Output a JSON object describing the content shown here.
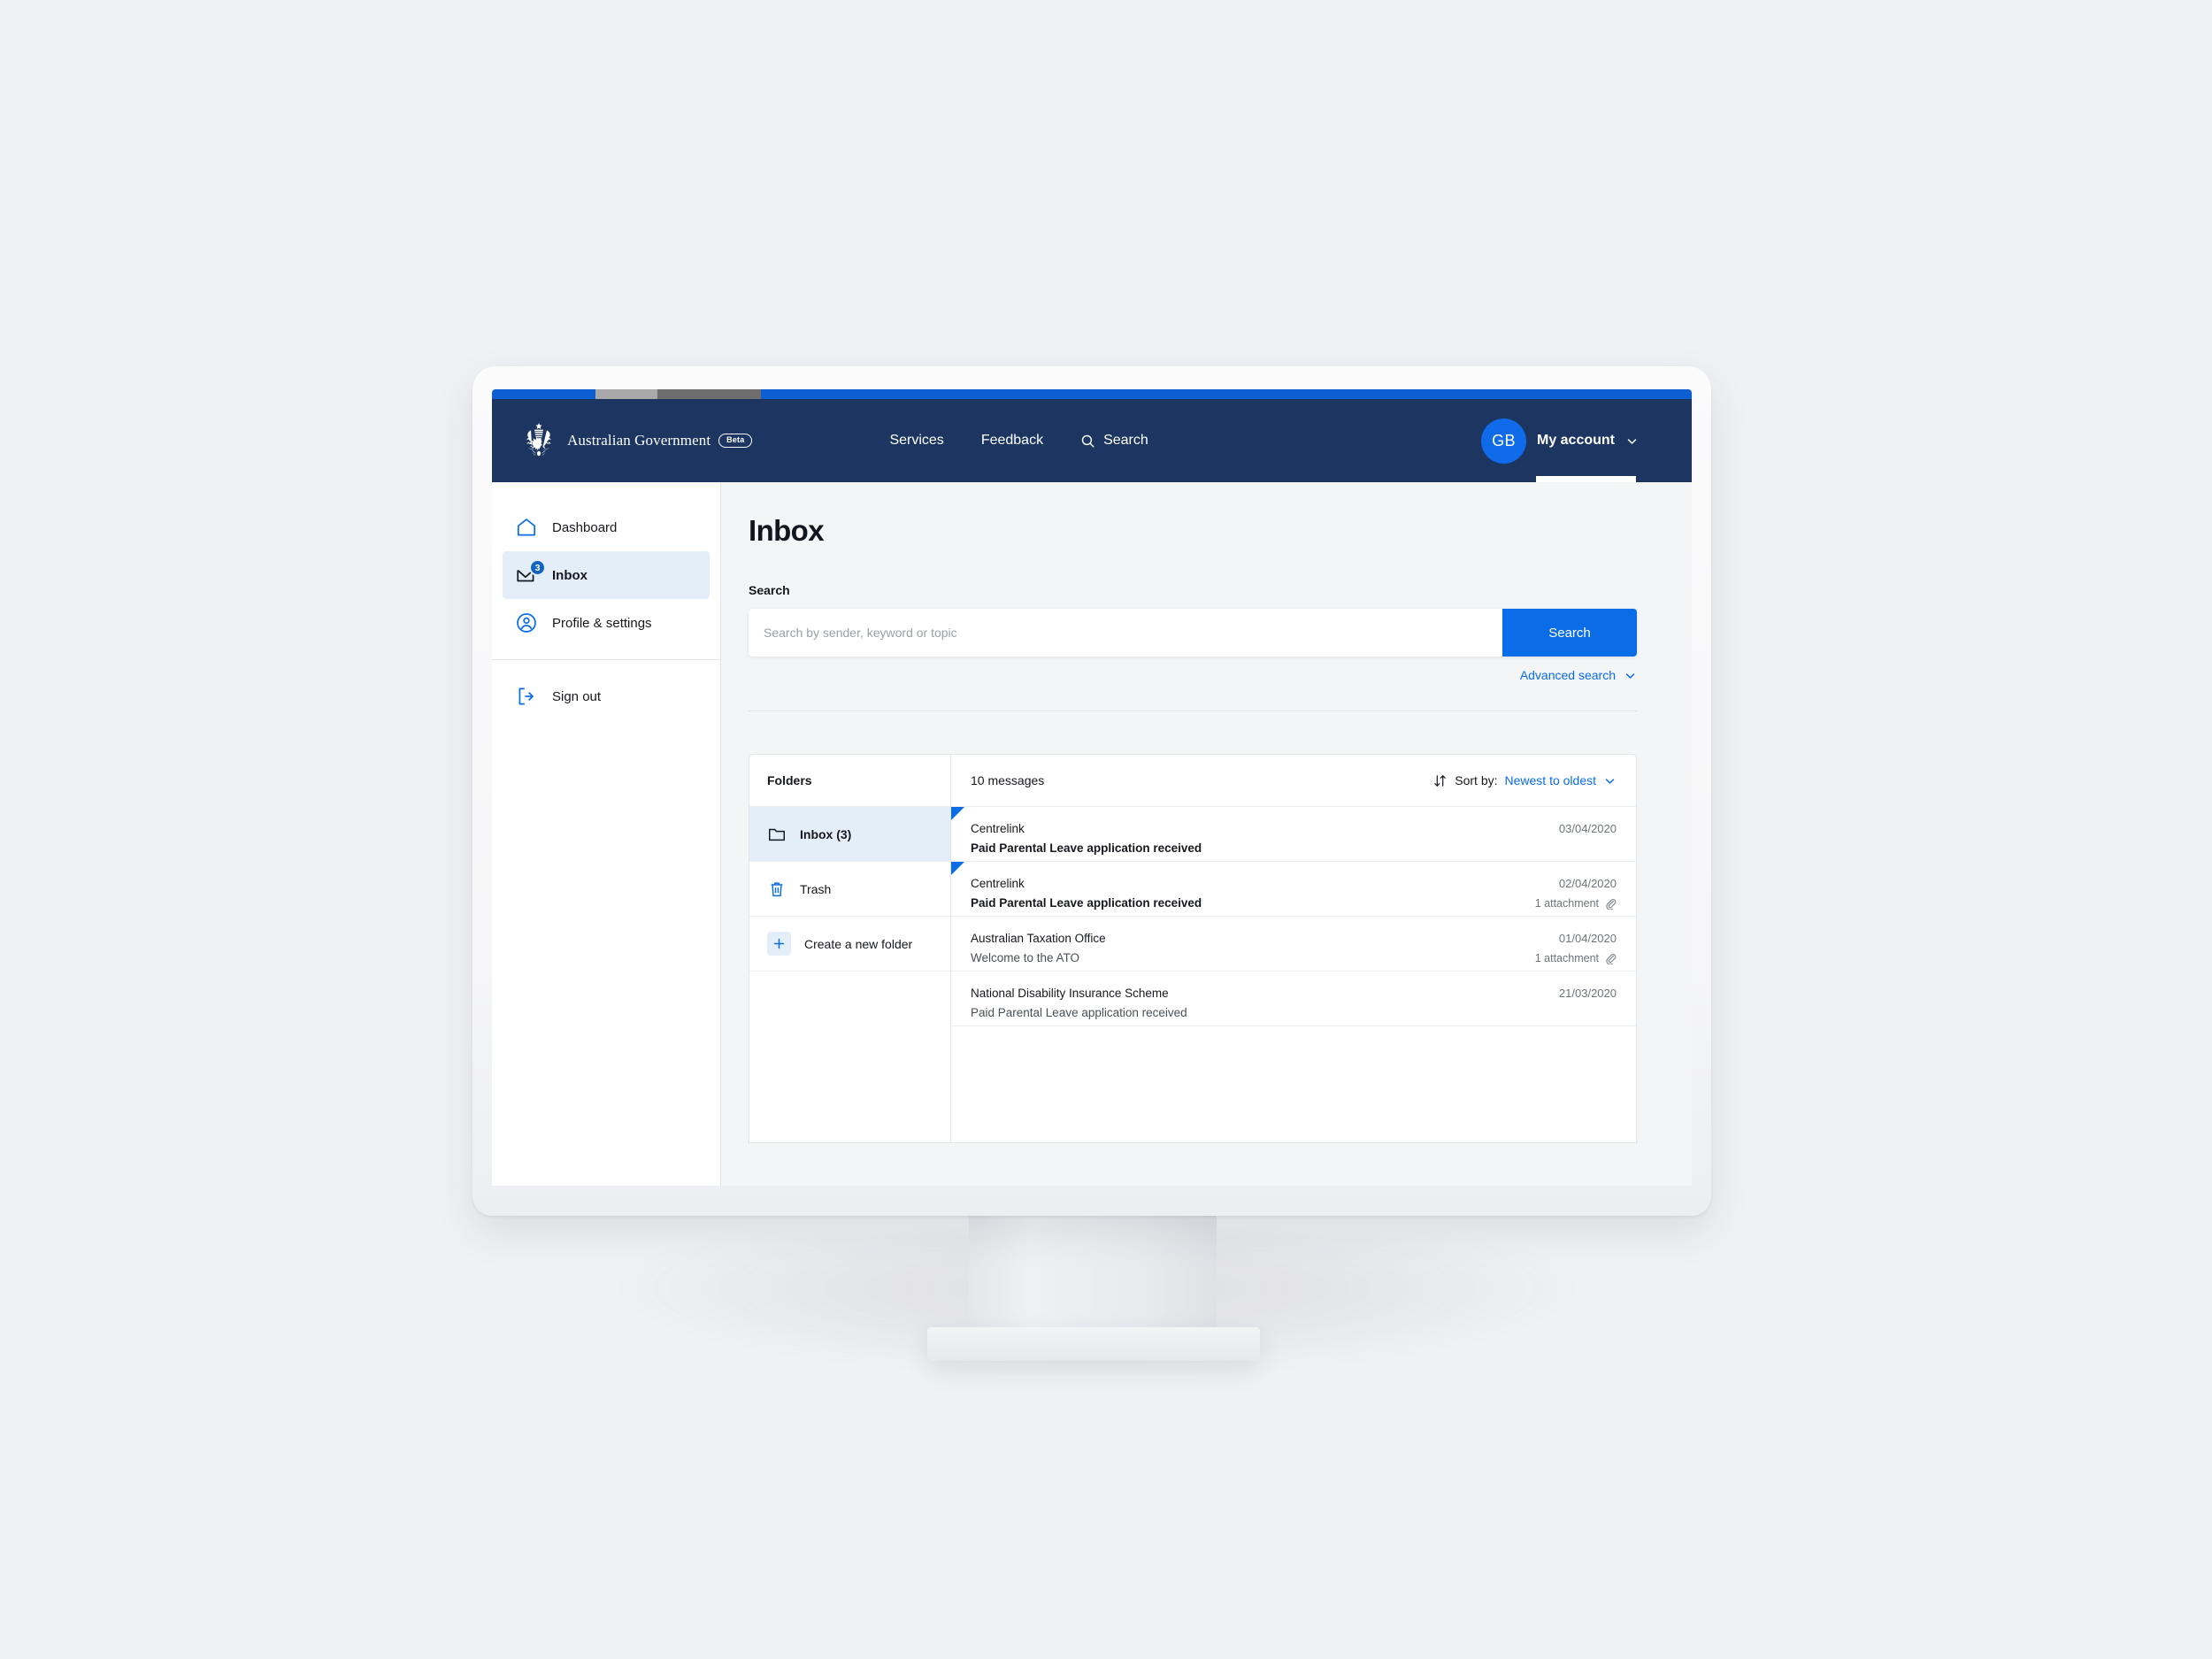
{
  "accent_bar": {
    "segments": [
      {
        "name": "blue-left",
        "color": "#0b5fd0",
        "width_pct": 8.6
      },
      {
        "name": "light-gray",
        "color": "#a9a9a9",
        "width_pct": 5.2
      },
      {
        "name": "dark-gray",
        "color": "#6e6e6e",
        "width_pct": 8.6
      },
      {
        "name": "blue-right",
        "color": "#0b5fd0",
        "width_pct": 77.6
      }
    ]
  },
  "colors": {
    "header_navy": "#1c3661",
    "accent_blue": "#0b6ce8",
    "avatar_blue": "#0f6bea",
    "page_background": "#f4f5f6",
    "panel_white": "#ffffff",
    "selected_blue_tint": "#e4eef9",
    "border_gray": "#e3e5e8",
    "muted_text": "#6e747c"
  },
  "header": {
    "brand_text": "Australian Government",
    "beta_label": "Beta",
    "crest_icon": "australian-coat-of-arms",
    "nav": [
      {
        "label": "Services",
        "icon": null
      },
      {
        "label": "Feedback",
        "icon": null
      },
      {
        "label": "Search",
        "icon": "search-icon"
      }
    ],
    "account": {
      "avatar_initials": "GB",
      "label": "My account",
      "chevron_icon": "chevron-down-icon"
    }
  },
  "sidebar": {
    "items": [
      {
        "label": "Dashboard",
        "icon": "home-icon",
        "active": false,
        "badge": null
      },
      {
        "label": "Inbox",
        "icon": "envelope-icon",
        "active": true,
        "badge": "3"
      },
      {
        "label": "Profile & settings",
        "icon": "user-circle-icon",
        "active": false,
        "badge": null
      }
    ],
    "footer_items": [
      {
        "label": "Sign out",
        "icon": "sign-out-icon",
        "active": false,
        "badge": null
      }
    ]
  },
  "main": {
    "page_title": "Inbox",
    "search": {
      "label": "Search",
      "placeholder": "Search by sender, keyword or topic",
      "value": "",
      "button_label": "Search",
      "advanced_label": "Advanced search",
      "advanced_chevron_icon": "chevron-down-icon"
    },
    "folders": {
      "heading": "Folders",
      "items": [
        {
          "label": "Inbox (3)",
          "icon": "folder-icon",
          "active": true
        },
        {
          "label": "Trash",
          "icon": "trash-icon",
          "active": false
        },
        {
          "label": "Create a new folder",
          "icon": "plus-icon",
          "active": false
        }
      ]
    },
    "messages": {
      "count_label": "10 messages",
      "sort_icon": "sort-arrows-icon",
      "sort_by_label": "Sort by:",
      "sort_value": "Newest to oldest",
      "sort_chevron_icon": "chevron-down-icon",
      "rows": [
        {
          "sender": "Centrelink",
          "subject": "Paid Parental Leave application received",
          "date": "03/04/2020",
          "attachment": "",
          "unread": true
        },
        {
          "sender": "Centrelink",
          "subject": "Paid Parental Leave application received",
          "date": "02/04/2020",
          "attachment": "1 attachment",
          "unread": true
        },
        {
          "sender": "Australian Taxation Office",
          "subject": "Welcome to the ATO",
          "date": "01/04/2020",
          "attachment": "1 attachment",
          "unread": false
        },
        {
          "sender": "National Disability Insurance Scheme",
          "subject": "Paid Parental Leave application received",
          "date": "21/03/2020",
          "attachment": "",
          "unread": false
        }
      ]
    }
  }
}
